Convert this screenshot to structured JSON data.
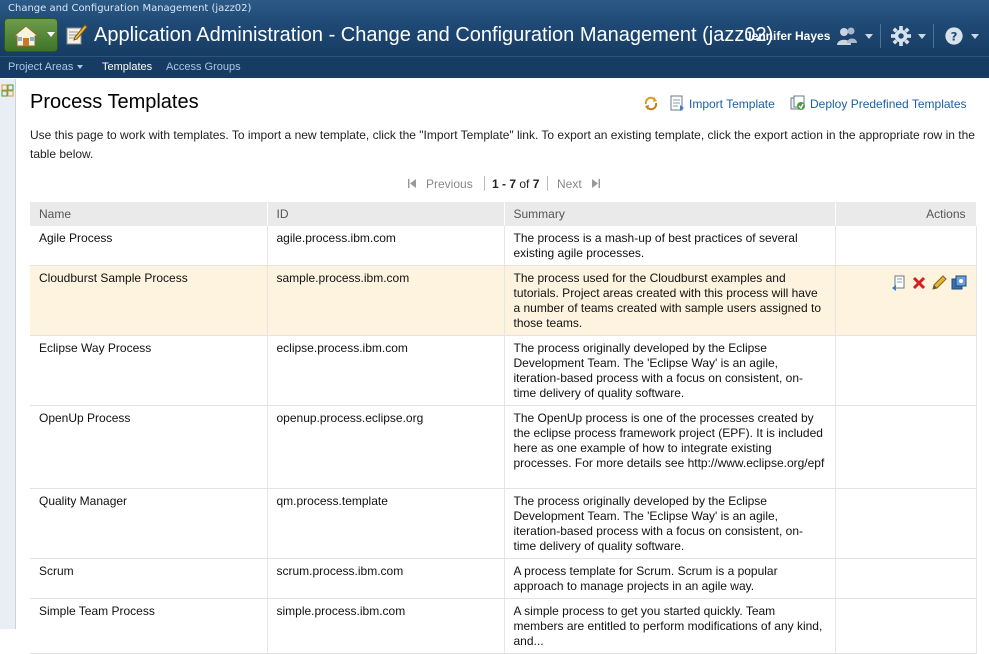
{
  "window": {
    "caption": "Change and Configuration Management (jazz02)"
  },
  "header": {
    "title": "Application Administration - Change and Configuration Management (jazz02)",
    "user": "Jennifer Hayes",
    "icons": [
      "home-icon",
      "admin-pen-icon",
      "users-icon",
      "gear-icon",
      "help-icon"
    ]
  },
  "nav": {
    "items": [
      {
        "label": "Project Areas",
        "has_menu": true,
        "active": false
      },
      {
        "label": "Templates",
        "active": true
      },
      {
        "label": "Access Groups",
        "active": false
      }
    ]
  },
  "page": {
    "title": "Process Templates",
    "import_label": "Import Template",
    "deploy_label": "Deploy Predefined Templates",
    "description": "Use this page to work with templates. To import a new template, click the \"Import Template\" link. To export an existing template, click the export action in the appropriate row in the table below."
  },
  "pager": {
    "previous": "Previous",
    "range": "1 - 7",
    "of_label": "of",
    "total": "7",
    "next": "Next"
  },
  "table": {
    "columns": [
      "Name",
      "ID",
      "Summary",
      "Actions"
    ],
    "rows": [
      {
        "name": "Agile Process",
        "id": "agile.process.ibm.com",
        "summary": "The process is a mash-up of best practices of several existing agile processes."
      },
      {
        "name": "Cloudburst Sample Process",
        "id": "sample.process.ibm.com",
        "summary": "The process used for the Cloudburst examples and tutorials. Project areas created with this process will have a number of teams created with sample users assigned to those teams."
      },
      {
        "name": "Eclipse Way Process",
        "id": "eclipse.process.ibm.com",
        "summary": "The process originally developed by the Eclipse Development Team. The 'Eclipse Way' is an agile, iteration-based process with a focus on consistent, on-time delivery of quality software."
      },
      {
        "name": "OpenUp Process",
        "id": "openup.process.eclipse.org",
        "summary": "The OpenUp process is one of the processes created by the eclipse process framework project (EPF). It is included here as one example of how to integrate existing processes. For more details see http://www.eclipse.org/epf"
      },
      {
        "name": "Quality Manager",
        "id": "qm.process.template",
        "summary": "The process originally developed by the Eclipse Development Team. The 'Eclipse Way' is an agile, iteration-based process with a focus on consistent, on-time delivery of quality software."
      },
      {
        "name": "Scrum",
        "id": "scrum.process.ibm.com",
        "summary": "A process template for Scrum. Scrum is a popular approach to manage projects in an agile way."
      },
      {
        "name": "Simple Team Process",
        "id": "simple.process.ibm.com",
        "summary": "A simple process to get you started quickly. Team members are entitled to perform modifications of any kind, and..."
      }
    ],
    "highlighted_row": 1,
    "row_action_icons": [
      "export-icon",
      "delete-icon",
      "edit-icon",
      "deploy-icon"
    ]
  },
  "colors": {
    "banner": "#1f4a76",
    "link": "#1a5fa8",
    "highlight_row": "#fdf3df",
    "header_cell": "#eaeaea"
  }
}
